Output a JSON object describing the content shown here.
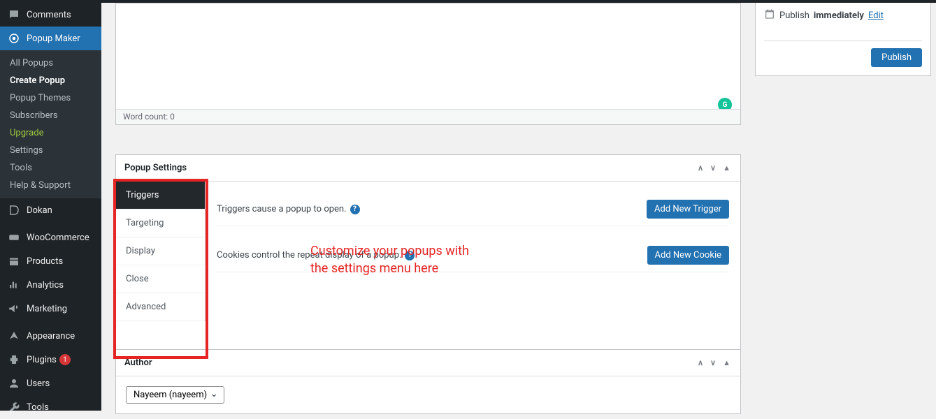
{
  "sidebar": {
    "comments": "Comments",
    "popup_maker": "Popup Maker",
    "submenu": {
      "all_popups": "All Popups",
      "create_popup": "Create Popup",
      "popup_themes": "Popup Themes",
      "subscribers": "Subscribers",
      "upgrade": "Upgrade",
      "settings": "Settings",
      "tools": "Tools",
      "help_support": "Help & Support"
    },
    "dokan": "Dokan",
    "woocommerce": "WooCommerce",
    "products": "Products",
    "analytics": "Analytics",
    "marketing": "Marketing",
    "appearance": "Appearance",
    "plugins": "Plugins",
    "plugins_count": "1",
    "users": "Users",
    "tools": "Tools"
  },
  "editor": {
    "word_count": "Word count: 0"
  },
  "publish": {
    "schedule_label": "Publish",
    "immediately": "immediately",
    "edit": "Edit",
    "button": "Publish"
  },
  "settings": {
    "header": "Popup Settings",
    "tabs": {
      "triggers": "Triggers",
      "targeting": "Targeting",
      "display": "Display",
      "close": "Close",
      "advanced": "Advanced"
    },
    "triggers_desc": "Triggers cause a popup to open.",
    "cookies_desc": "Cookies control the repeat display of a popup.",
    "add_trigger": "Add New Trigger",
    "add_cookie": "Add New Cookie"
  },
  "annotation": {
    "line1": "Customize your popups with",
    "line2": "the settings menu here"
  },
  "author": {
    "header": "Author",
    "selected": "Nayeem (nayeem)"
  }
}
